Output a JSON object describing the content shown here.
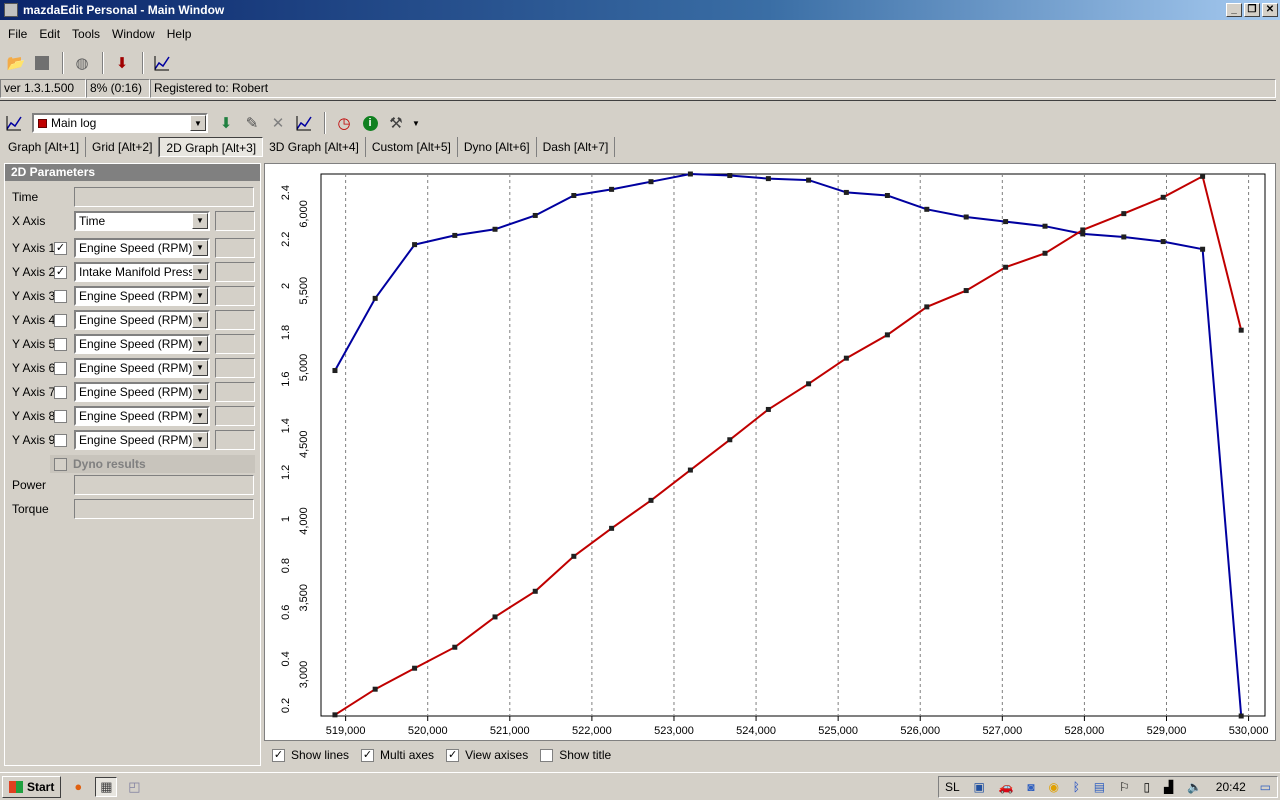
{
  "window": {
    "title": "mazdaEdit Personal - Main Window"
  },
  "menu": [
    "File",
    "Edit",
    "Tools",
    "Window",
    "Help"
  ],
  "status": {
    "version": "ver 1.3.1.500",
    "progress": "8% (0:16)",
    "registered": "Registered to: Robert"
  },
  "toolbar2": {
    "log_name": "Main log"
  },
  "tabs": [
    "Graph [Alt+1]",
    "Grid [Alt+2]",
    "2D Graph [Alt+3]",
    "3D Graph [Alt+4]",
    "Custom [Alt+5]",
    "Dyno [Alt+6]",
    "Dash [Alt+7]"
  ],
  "params": {
    "header": "2D Parameters",
    "time_label": "Time",
    "xaxis_label": "X Axis",
    "xaxis_value": "Time",
    "yaxes": [
      {
        "label": "Y Axis 1",
        "checked": true,
        "value": "Engine Speed (RPM)"
      },
      {
        "label": "Y Axis 2",
        "checked": true,
        "value": "Intake Manifold Pressure"
      },
      {
        "label": "Y Axis 3",
        "checked": false,
        "value": "Engine Speed (RPM)"
      },
      {
        "label": "Y Axis 4",
        "checked": false,
        "value": "Engine Speed (RPM)"
      },
      {
        "label": "Y Axis 5",
        "checked": false,
        "value": "Engine Speed (RPM)"
      },
      {
        "label": "Y Axis 6",
        "checked": false,
        "value": "Engine Speed (RPM)"
      },
      {
        "label": "Y Axis 7",
        "checked": false,
        "value": "Engine Speed (RPM)"
      },
      {
        "label": "Y Axis 8",
        "checked": false,
        "value": "Engine Speed (RPM)"
      },
      {
        "label": "Y Axis 9",
        "checked": false,
        "value": "Engine Speed (RPM)"
      }
    ],
    "dyno_label": "Dyno results",
    "power_label": "Power",
    "torque_label": "Torque"
  },
  "options": {
    "show_lines": "Show lines",
    "multi_axes": "Multi axes",
    "view_axises": "View axises",
    "show_title": "Show title"
  },
  "taskbar": {
    "start": "Start",
    "lang": "SL",
    "clock": "20:42"
  },
  "colors": {
    "series_blue": "#0000a0",
    "series_red": "#c00000"
  },
  "chart_data": {
    "type": "line",
    "x_ticks": [
      "519,000",
      "520,000",
      "521,000",
      "522,000",
      "523,000",
      "524,000",
      "525,000",
      "526,000",
      "527,000",
      "528,000",
      "529,000",
      "530,000"
    ],
    "xlim": [
      518700,
      530200
    ],
    "y_left_ticks": [
      "3,000",
      "3,500",
      "4,000",
      "4,500",
      "5,000",
      "5,500",
      "6,000"
    ],
    "y_left_lim": [
      2730,
      6260
    ],
    "y_right_ticks": [
      "0.2",
      "0.4",
      "0.6",
      "0.8",
      "1",
      "1.2",
      "1.4",
      "1.6",
      "1.8",
      "2",
      "2.2",
      "2.4"
    ],
    "y_right_lim": [
      0.155,
      2.48
    ],
    "series": [
      {
        "axis": "left",
        "x": [
          518870,
          519360,
          519840,
          520330,
          520820,
          521310,
          521780,
          522240,
          522720,
          523200,
          523680,
          524150,
          524640,
          525100,
          525600,
          526080,
          526560,
          527040,
          527520,
          527980,
          528480,
          528960,
          529440,
          529910
        ],
        "values": [
          4980,
          5450,
          5800,
          5860,
          5900,
          5990,
          6120,
          6160,
          6210,
          6260,
          6250,
          6230,
          6220,
          6140,
          6120,
          6030,
          5980,
          5950,
          5920,
          5870,
          5850,
          5820,
          5770,
          2730
        ]
      },
      {
        "axis": "right",
        "x": [
          518870,
          519360,
          519840,
          520330,
          520820,
          521310,
          521780,
          522240,
          522720,
          523200,
          523680,
          524150,
          524640,
          525100,
          525600,
          526080,
          526560,
          527040,
          527520,
          527980,
          528480,
          528960,
          529440,
          529910
        ],
        "values": [
          0.16,
          0.27,
          0.36,
          0.45,
          0.58,
          0.69,
          0.84,
          0.96,
          1.08,
          1.21,
          1.34,
          1.47,
          1.58,
          1.69,
          1.79,
          1.91,
          1.98,
          2.08,
          2.14,
          2.24,
          2.31,
          2.38,
          2.47,
          1.81
        ]
      }
    ]
  }
}
